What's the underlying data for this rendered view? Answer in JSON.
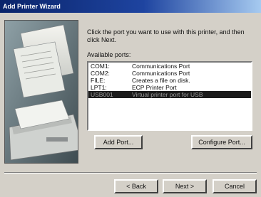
{
  "window": {
    "title": "Add Printer Wizard"
  },
  "instruction": "Click the port you want to use with this printer, and then click Next.",
  "ports_label": "Available ports:",
  "ports": [
    {
      "port": "COM1:",
      "description": "Communications Port",
      "selected": false
    },
    {
      "port": "COM2:",
      "description": "Communications Port",
      "selected": false
    },
    {
      "port": "FILE:",
      "description": "Creates a file on disk.",
      "selected": false
    },
    {
      "port": "LPT1:",
      "description": "ECP Printer Port",
      "selected": false
    },
    {
      "port": "USB001",
      "description": "Virtual printer port for USB",
      "selected": true
    }
  ],
  "buttons": {
    "add_port": "Add Port...",
    "configure_port": "Configure Port...",
    "back": "< Back",
    "next": "Next >",
    "cancel": "Cancel"
  },
  "colors": {
    "title_bar_start": "#0a246a",
    "title_bar_end": "#a6caf0",
    "dialog_face": "#d4d0c8",
    "selection": "#1b1b1b"
  }
}
